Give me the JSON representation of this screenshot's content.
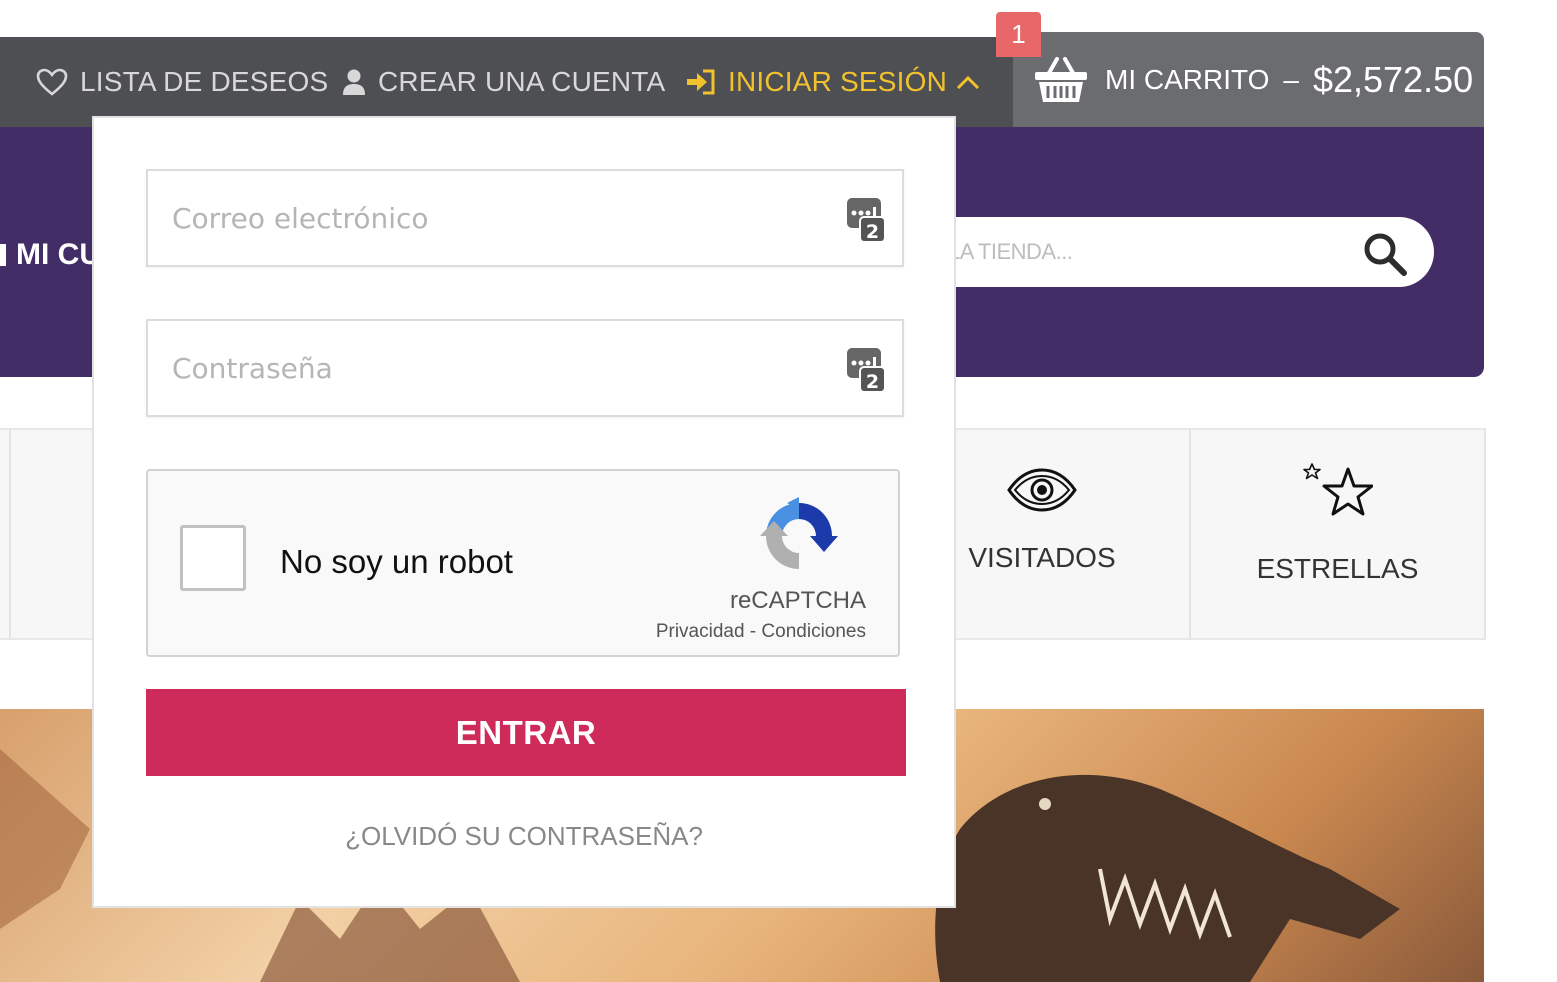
{
  "nav": {
    "wishlist_label": "LISTA DE DESEOS",
    "create_account_label": "CREAR UNA CUENTA",
    "login_label": "INICIAR SESIÓN"
  },
  "cart": {
    "badge_count": "1",
    "label": "MI CARRITO",
    "separator": "–",
    "total": "$2,572.50"
  },
  "header": {
    "account_partial": "MI CU",
    "search_placeholder_visible": "LA TIENDA..."
  },
  "shortcuts": [
    {
      "label": "VISITADOS",
      "icon": "eye-icon"
    },
    {
      "label": "ESTRELLAS",
      "icon": "star-icon"
    }
  ],
  "login_form": {
    "email_placeholder": "Correo electrónico",
    "password_placeholder": "Contraseña",
    "captcha_label": "No soy un robot",
    "captcha_brand": "reCAPTCHA",
    "captcha_privacy": "Privacidad",
    "captcha_links_sep": " - ",
    "captcha_terms": "Condiciones",
    "submit_label": "ENTRAR",
    "forgot_label": "¿OLVIDÓ SU CONTRASEÑA?"
  },
  "colors": {
    "nav_bg": "#4e4f53",
    "accent_yellow": "#f2c12e",
    "header_purple": "#432d66",
    "submit_pink": "#cf2b5a",
    "badge_red": "#e8686a"
  }
}
